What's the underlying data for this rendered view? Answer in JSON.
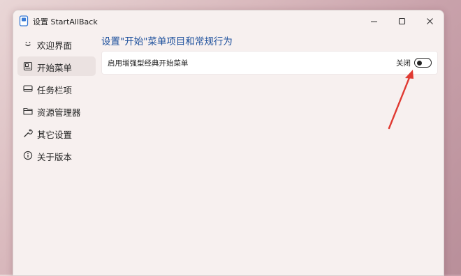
{
  "window": {
    "title": "设置 StartAllBack",
    "controls": {
      "minimize_icon": "minimize-icon",
      "maximize_icon": "maximize-icon",
      "close_icon": "close-icon"
    }
  },
  "sidebar": {
    "items": [
      {
        "label": "欢迎界面",
        "icon": "smile-icon",
        "selected": false
      },
      {
        "label": "开始菜单",
        "icon": "start-menu-icon",
        "selected": true
      },
      {
        "label": "任务栏项",
        "icon": "taskbar-icon",
        "selected": false
      },
      {
        "label": "资源管理器",
        "icon": "folder-icon",
        "selected": false
      },
      {
        "label": "其它设置",
        "icon": "wrench-icon",
        "selected": false
      },
      {
        "label": "关于版本",
        "icon": "info-icon",
        "selected": false
      }
    ]
  },
  "main": {
    "title": "设置\"开始\"菜单项目和常规行为",
    "settings": [
      {
        "label": "启用增强型经典开始菜单",
        "state_label": "关闭",
        "enabled": false
      }
    ]
  },
  "colors": {
    "title_blue": "#1c4f9c",
    "annotation_red": "#e03a32"
  }
}
